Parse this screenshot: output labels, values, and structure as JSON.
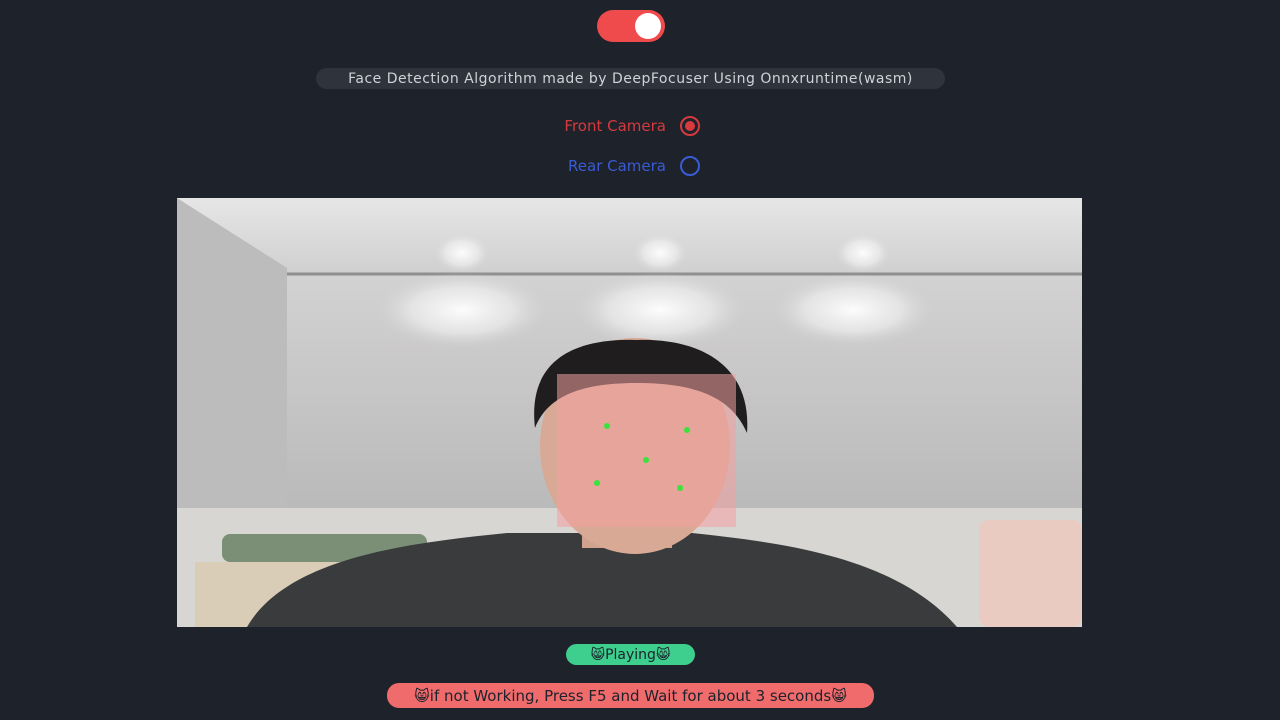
{
  "toggle": {
    "state": "on",
    "color": "#ef4b4c"
  },
  "info": {
    "text": "Face Detection Algorithm made by DeepFocuser Using Onnxruntime(wasm)"
  },
  "camera_options": [
    {
      "label": "Front Camera",
      "selected": true,
      "color": "#d63a3e"
    },
    {
      "label": "Rear Camera",
      "selected": false,
      "color": "#3a5bd4"
    }
  ],
  "status": {
    "text": "😸Playing😸",
    "color": "#3ecf8e"
  },
  "hint": {
    "text": "😸if not Working, Press F5 and Wait for about 3 seconds😸",
    "color": "#f06b6b"
  },
  "detection": {
    "box_color": "#f4a0a0",
    "landmark_color": "#39e23d"
  }
}
